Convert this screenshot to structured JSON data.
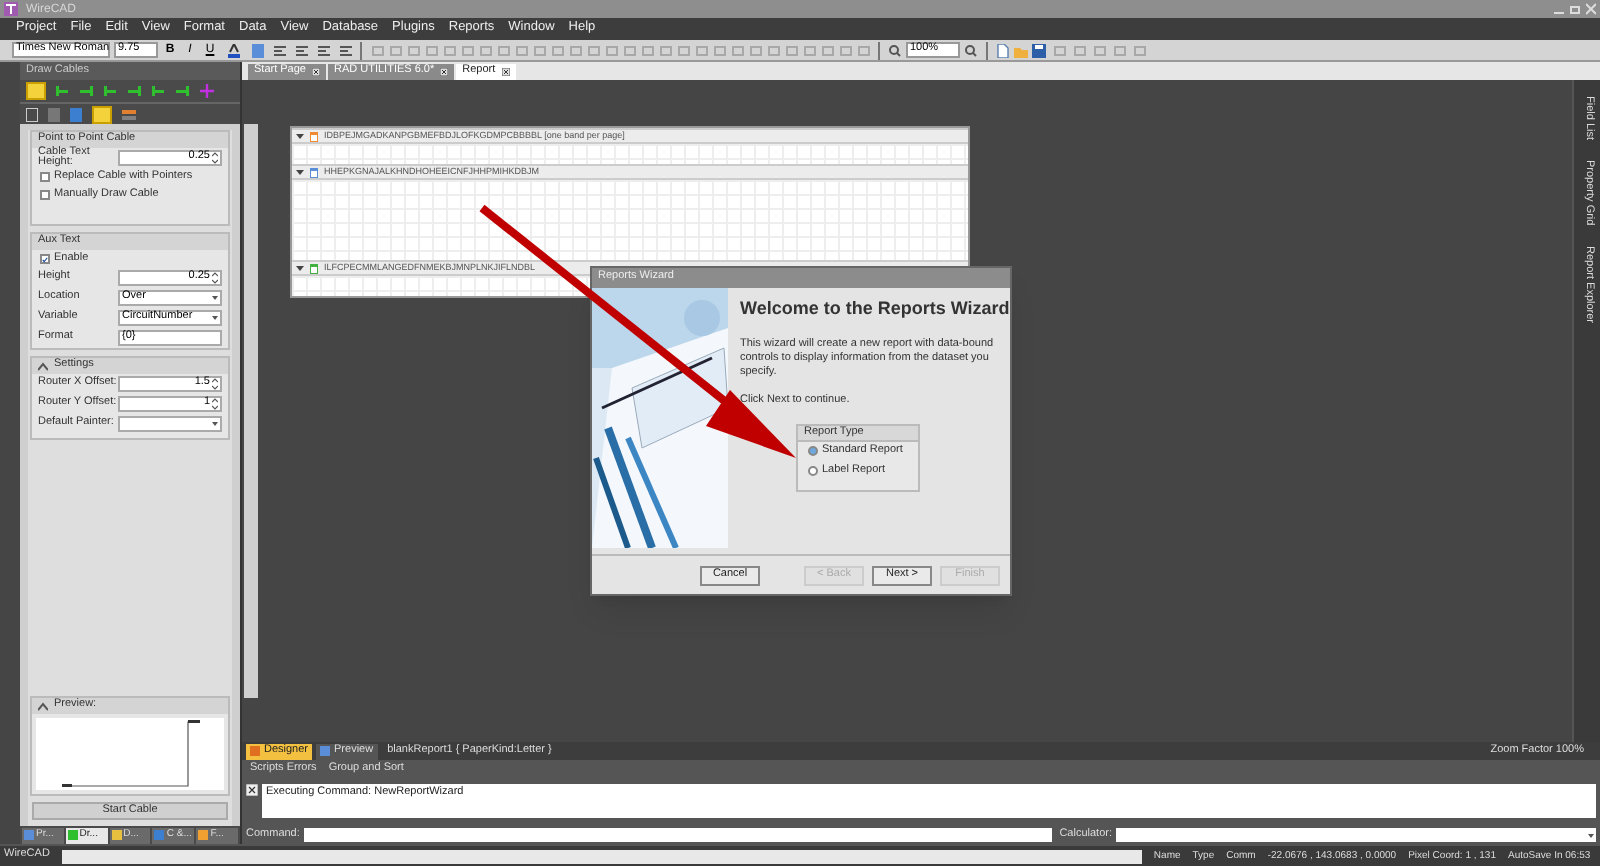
{
  "window": {
    "title": "WireCAD"
  },
  "menu": [
    "Project",
    "File",
    "Edit",
    "View",
    "Format",
    "Data",
    "View",
    "Database",
    "Plugins",
    "Reports",
    "Window",
    "Help"
  ],
  "toolbar": {
    "font": "Times New Roman",
    "size": "9.75",
    "format_buttons": [
      "B",
      "I",
      "U"
    ],
    "zoom": "100%"
  },
  "left_panel": {
    "title": "Draw Cables",
    "section": "Point to Point Cable",
    "cable_text_height": {
      "label": "Cable Text Height:",
      "value": "0.25"
    },
    "options": [
      {
        "label": "Replace Cable with Pointers",
        "checked": false
      },
      {
        "label": "Manually Draw Cable",
        "checked": false
      }
    ],
    "aux_text": {
      "title": "Aux Text",
      "enable": {
        "label": "Enable",
        "checked": true
      },
      "fields": [
        {
          "kind": "spin",
          "label": "Height",
          "value": "0.25"
        },
        {
          "kind": "combo",
          "label": "Location",
          "value": "Over"
        },
        {
          "kind": "combo",
          "label": "Variable",
          "value": "CircuitNumber"
        },
        {
          "kind": "text",
          "label": "Format",
          "value": "{0}"
        }
      ]
    },
    "settings": {
      "title": "Settings",
      "fields": [
        {
          "kind": "spin",
          "label": "Router X Offset:",
          "value": "1.5"
        },
        {
          "kind": "spin",
          "label": "Router Y Offset:",
          "value": "1"
        },
        {
          "kind": "combo",
          "label": "Default Painter:"
        }
      ]
    },
    "preview": {
      "title": "Preview:"
    },
    "start_button": "Start Cable",
    "bottom_tabs": [
      {
        "label": "Pr...",
        "selected": false
      },
      {
        "label": "Dr...",
        "selected": true
      },
      {
        "label": "D...",
        "selected": false
      },
      {
        "label": "C &...",
        "selected": false
      },
      {
        "label": "F...",
        "selected": false
      }
    ]
  },
  "doc_tabs": [
    {
      "label": "Start Page",
      "selected": false
    },
    {
      "label": "RAD UTILITIES 6.0*",
      "selected": false
    },
    {
      "label": "Report",
      "selected": true
    }
  ],
  "report_bands": [
    {
      "kind": "header",
      "title": "IDBPEJMGADKANPGBMEFBDJLOFKGDMPCBBBBL [one band per page]"
    },
    {
      "kind": "detail",
      "title": "HHEPKGNAJALKHNDHOHEEICNFJHHPMIHKDBJM"
    },
    {
      "kind": "footer",
      "title": "ILFCPECMMLANGEDFNMEKBJMNPLNKJIFLNDBL"
    }
  ],
  "wizard": {
    "title": "Reports Wizard",
    "heading": "Welcome to the Reports Wizard",
    "text": "This wizard will create a new report with data-bound controls to display information from the dataset you specify.",
    "hint": "Click Next to continue.",
    "group_title": "Report Type",
    "options": [
      {
        "label": "Standard Report",
        "selected": true
      },
      {
        "label": "Label Report",
        "selected": false
      }
    ],
    "buttons": [
      {
        "label": "Cancel",
        "disabled": false
      },
      {
        "label": "< Back",
        "disabled": true
      },
      {
        "label": "Next >",
        "disabled": false
      },
      {
        "label": "Finish",
        "disabled": true
      }
    ]
  },
  "designer_tabs": [
    {
      "label": "Designer",
      "selected": true
    },
    {
      "label": "Preview",
      "selected": false
    }
  ],
  "report_name": "blankReport1 { PaperKind:Letter }",
  "zoom_factor": "Zoom Factor 100%",
  "output_tabs": [
    "Scripts Errors",
    "Group and Sort"
  ],
  "output": "Executing Command: NewReportWizard",
  "command_label": "Command:",
  "calculator_label": "Calculator:",
  "side_tabs": [
    "Field List",
    "Property Grid",
    "Report Explorer"
  ],
  "status_bar": {
    "app": "WireCAD",
    "items": [
      "Name",
      "Type",
      "Comm",
      "-22.0676 , 143.0683 , 0.0000",
      "Pixel Coord: 1 , 131",
      "AutoSave In 06:53"
    ]
  }
}
